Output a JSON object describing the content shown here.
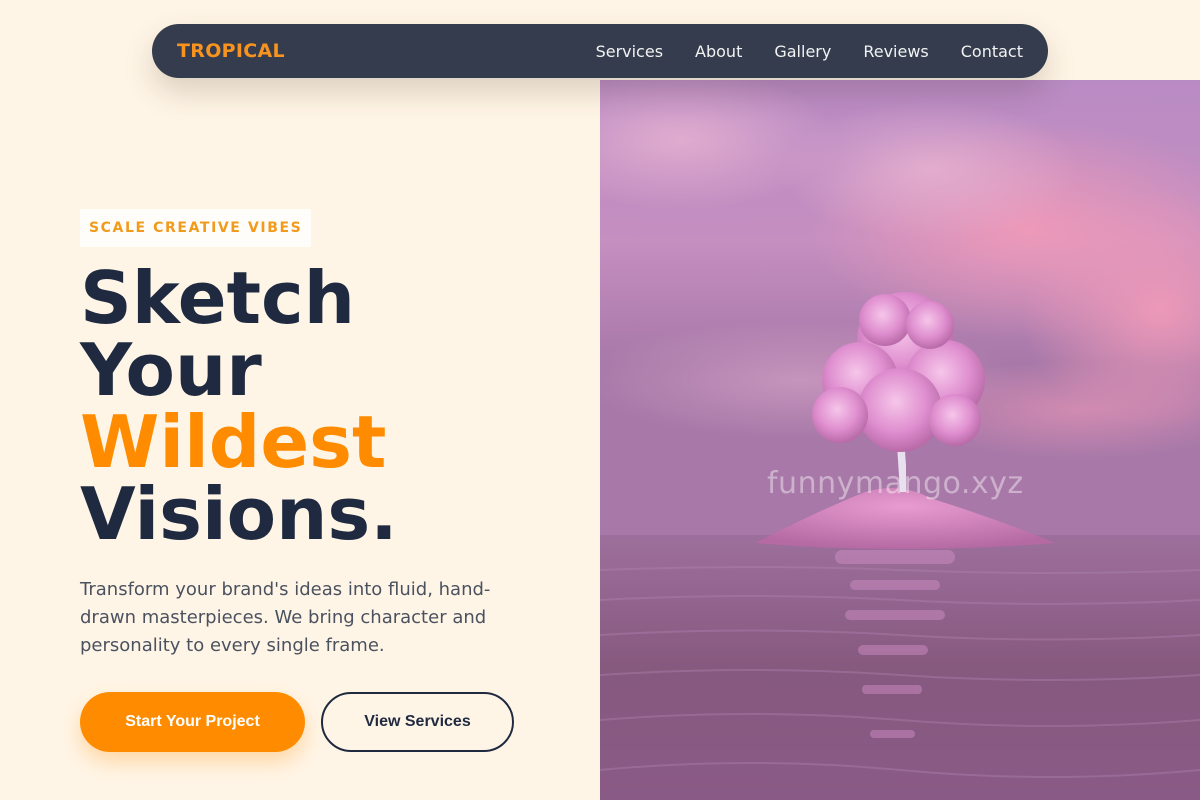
{
  "brand": {
    "logo_text": "TROPICAL"
  },
  "nav": {
    "links": [
      {
        "label": "Services"
      },
      {
        "label": "About"
      },
      {
        "label": "Gallery"
      },
      {
        "label": "Reviews"
      },
      {
        "label": "Contact"
      }
    ]
  },
  "hero": {
    "tagline": "SCALE CREATIVE VIBES",
    "headline": {
      "line1": "Sketch",
      "line2": "Your",
      "line3_accent": "Wildest",
      "line4": "Visions."
    },
    "description": "Transform your brand's ideas into fluid, hand-drawn masterpieces. We bring character and personality to every single frame.",
    "primary_cta": "Start Your Project",
    "secondary_cta": "View Services",
    "image_watermark": "funnymango.xyz"
  },
  "colors": {
    "background": "#fff5e6",
    "nav_background": "#343c4d",
    "accent": "#ff8c00",
    "heading": "#1f2a40",
    "body_text": "#4a5260"
  }
}
